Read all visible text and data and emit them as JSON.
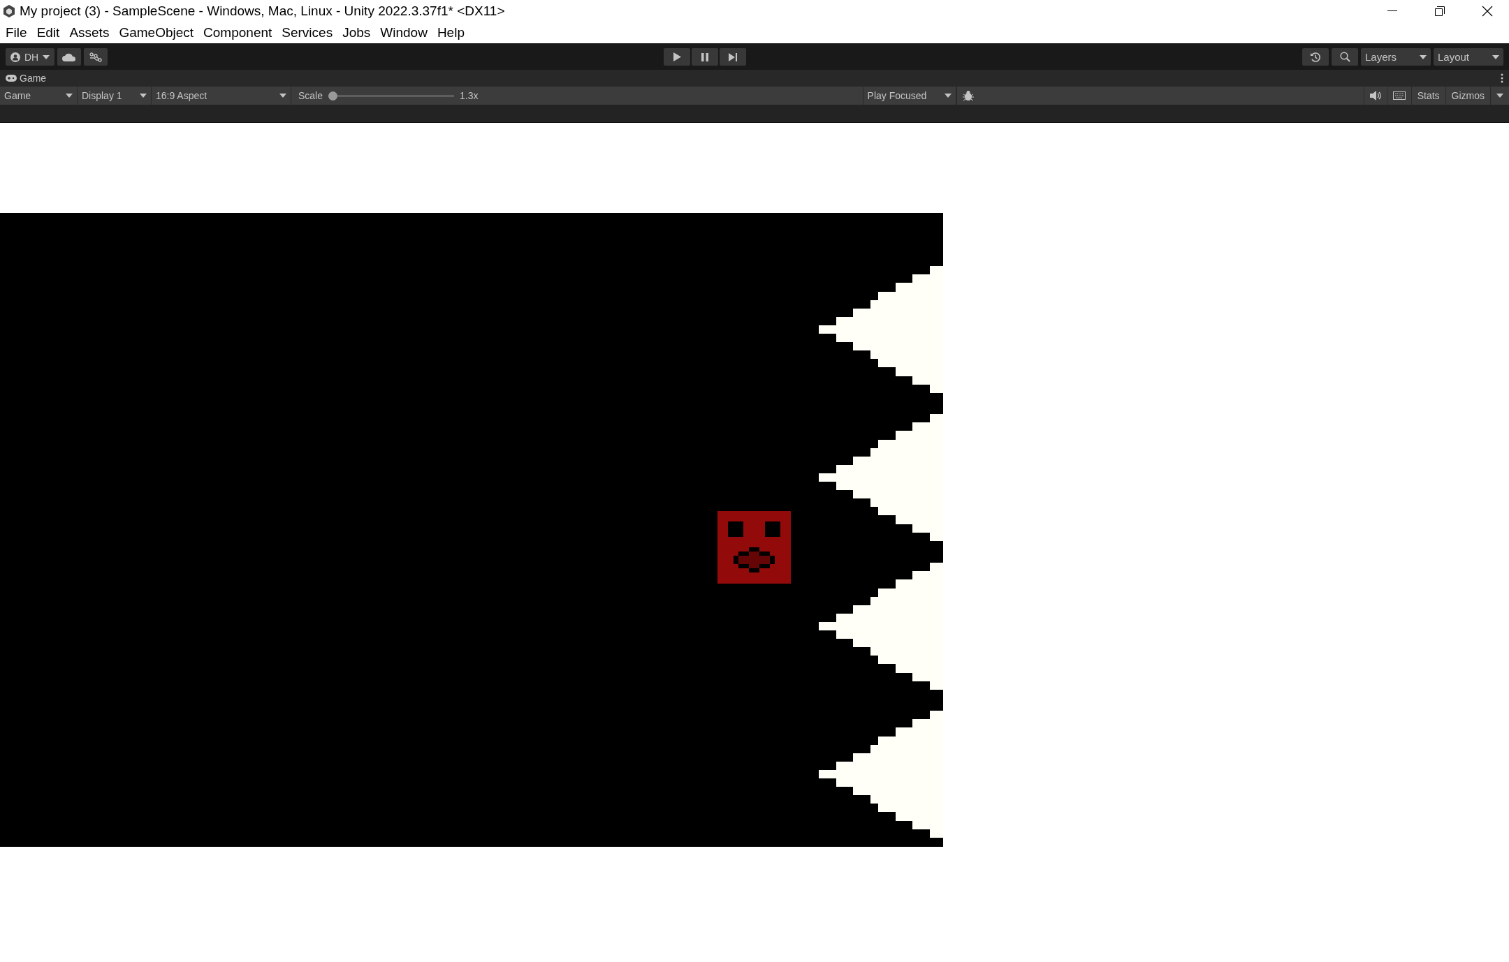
{
  "window": {
    "title": "My project (3) - SampleScene - Windows, Mac, Linux - Unity 2022.3.37f1* <DX11>"
  },
  "menu": [
    "File",
    "Edit",
    "Assets",
    "GameObject",
    "Component",
    "Services",
    "Jobs",
    "Window",
    "Help"
  ],
  "toolbar": {
    "account": "DH",
    "layers": "Layers",
    "layout": "Layout"
  },
  "game_tab": {
    "label": "Game"
  },
  "game_toolbar": {
    "view": "Game",
    "display": "Display 1",
    "aspect": "16:9 Aspect",
    "scale_label": "Scale",
    "scale": {
      "level": 0
    },
    "scale_reading": "1.3x",
    "play_mode": "Play Focused",
    "stats": "Stats",
    "gizmos": "Gizmos"
  }
}
